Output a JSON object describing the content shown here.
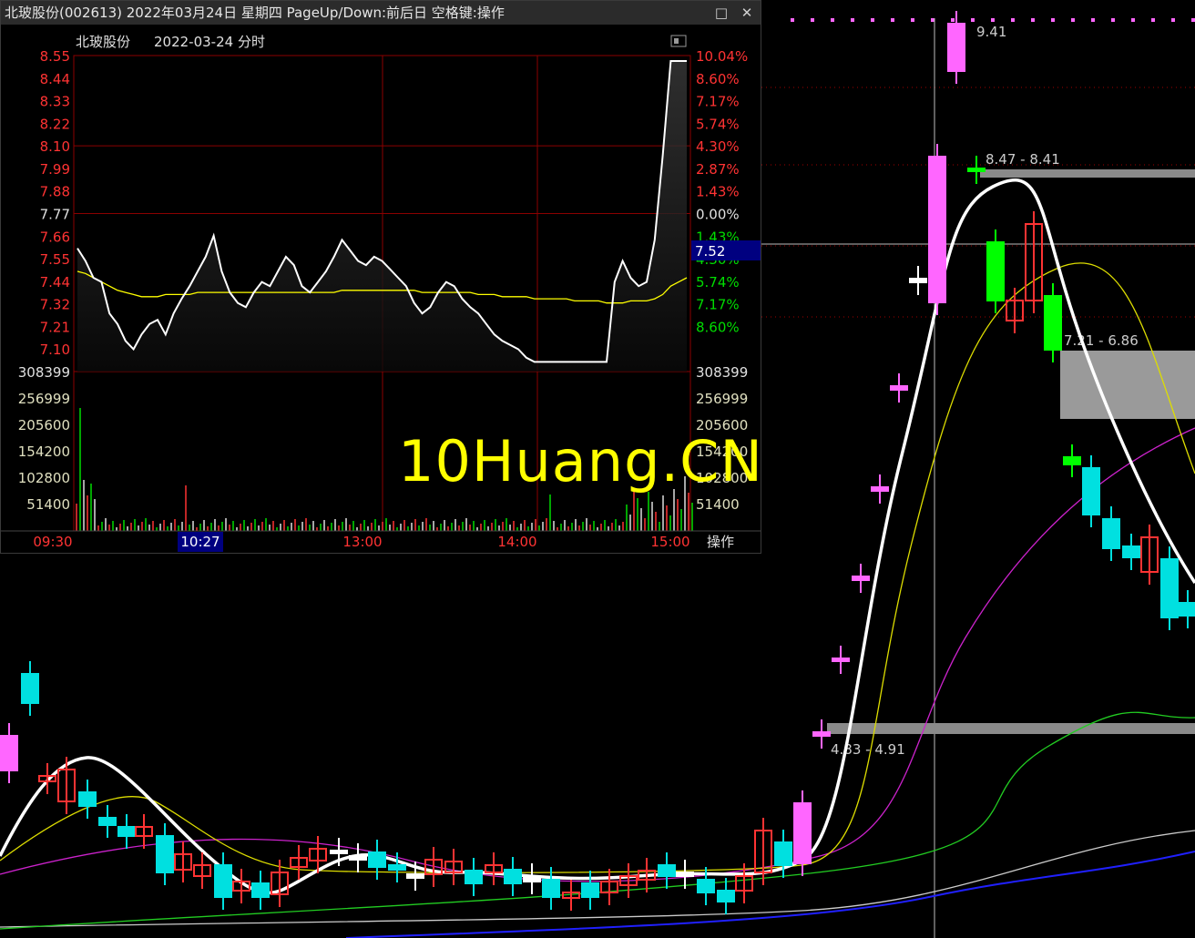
{
  "window": {
    "title": "北玻股份(002613) 2022年03月24日 星期四 PageUp/Down:前后日 空格键:操作",
    "restore_icon": "□",
    "close_icon": "✕"
  },
  "chart_header": {
    "name": "北玻股份",
    "date": "2022-03-24 分时",
    "panel_icon": "window-icon"
  },
  "colors": {
    "up": "#ff3333",
    "down": "#00e0e0",
    "down_fill": "#00ff00",
    "limit_up": "#ff66ff",
    "ma": "#ffff00",
    "grid": "#8b0000"
  },
  "chart_data": [
    {
      "type": "line",
      "name": "intraday",
      "price_ticks": [
        "8.55",
        "8.44",
        "8.33",
        "8.22",
        "8.10",
        "7.99",
        "7.88",
        "7.77",
        "7.66",
        "7.55",
        "7.44",
        "7.32",
        "7.21",
        "7.10"
      ],
      "pct_ticks": [
        "10.04%",
        "8.60%",
        "7.17%",
        "5.74%",
        "4.30%",
        "2.87%",
        "1.43%",
        "0.00%",
        "1.43%",
        "4.30%",
        "5.74%",
        "7.17%",
        "8.60%"
      ],
      "current_price": "7.52",
      "vol_ticks_left": [
        "308399",
        "256999",
        "205600",
        "154200",
        "102800",
        "51400"
      ],
      "vol_ticks_right": [
        "308399",
        "256999",
        "205600",
        "154200",
        "102800",
        "51400"
      ],
      "time_ticks": [
        "09:30",
        "10:27",
        "13:00",
        "14:00",
        "15:00"
      ],
      "cursor_time": "10:27",
      "action_label": "操作",
      "ylim": [
        7.1,
        8.55
      ],
      "price_path": [
        7.66,
        7.6,
        7.52,
        7.5,
        7.35,
        7.3,
        7.22,
        7.18,
        7.25,
        7.3,
        7.32,
        7.25,
        7.35,
        7.42,
        7.48,
        7.55,
        7.62,
        7.72,
        7.55,
        7.45,
        7.4,
        7.38,
        7.45,
        7.5,
        7.48,
        7.55,
        7.62,
        7.58,
        7.48,
        7.45,
        7.5,
        7.55,
        7.62,
        7.7,
        7.65,
        7.6,
        7.58,
        7.62,
        7.6,
        7.56,
        7.52,
        7.48,
        7.4,
        7.35,
        7.38,
        7.45,
        7.5,
        7.48,
        7.42,
        7.38,
        7.35,
        7.3,
        7.25,
        7.22,
        7.2,
        7.18,
        7.14,
        7.12,
        7.12,
        7.12,
        7.12,
        7.12,
        7.12,
        7.12,
        7.12,
        7.12,
        7.12,
        7.5,
        7.6,
        7.52,
        7.48,
        7.5,
        7.7,
        8.1,
        8.55,
        8.55,
        8.55
      ],
      "avg_path": [
        7.55,
        7.54,
        7.52,
        7.5,
        7.48,
        7.46,
        7.45,
        7.44,
        7.43,
        7.43,
        7.43,
        7.44,
        7.44,
        7.44,
        7.44,
        7.45,
        7.45,
        7.45,
        7.45,
        7.45,
        7.45,
        7.45,
        7.45,
        7.45,
        7.45,
        7.45,
        7.45,
        7.45,
        7.45,
        7.45,
        7.45,
        7.45,
        7.45,
        7.46,
        7.46,
        7.46,
        7.46,
        7.46,
        7.46,
        7.46,
        7.46,
        7.46,
        7.46,
        7.45,
        7.45,
        7.45,
        7.45,
        7.45,
        7.45,
        7.45,
        7.44,
        7.44,
        7.44,
        7.43,
        7.43,
        7.43,
        7.43,
        7.42,
        7.42,
        7.42,
        7.42,
        7.42,
        7.41,
        7.41,
        7.41,
        7.41,
        7.4,
        7.4,
        7.4,
        7.41,
        7.41,
        7.41,
        7.42,
        7.44,
        7.48,
        7.5,
        7.52
      ]
    },
    {
      "type": "candlestick",
      "name": "daily",
      "annotations": [
        {
          "text": "9.41"
        },
        {
          "text": "8.47 - 8.41"
        },
        {
          "text": "7.21 - 6.86"
        },
        {
          "text": "4.83 - 4.91"
        }
      ]
    }
  ],
  "watermark": "10Huang.CN"
}
